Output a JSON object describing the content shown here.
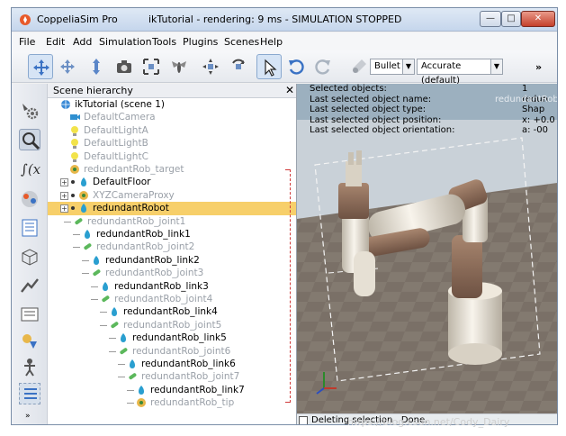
{
  "window": {
    "app_name": "CoppeliaSim Pro",
    "title": "ikTutorial - rendering: 9 ms - SIMULATION STOPPED",
    "controls": [
      "—",
      "□",
      "✕"
    ]
  },
  "menu": [
    "File",
    "Edit",
    "Add",
    "Simulation",
    "Tools",
    "Plugins",
    "Scenes",
    "Help"
  ],
  "toolbar": {
    "icons": [
      "move-camera-icon",
      "rotate-camera-icon",
      "shift-camera-icon",
      "camera-icon",
      "fit-view-icon",
      "fly-icon",
      "object-shift-icon",
      "object-rotate-icon",
      "pointer-select-icon",
      "undo-icon",
      "redo-icon",
      "dynamics-icon"
    ],
    "engine_value": "Bullet",
    "accuracy_value": "Accurate (default)",
    "more_label": "»"
  },
  "left_tools": [
    "sim-settings-icon",
    "selection-icon",
    "script-icon",
    "model-browser-icon",
    "hierarchy-icon",
    "object-properties-icon",
    "collections-icon",
    "paths-icon",
    "layers-icon",
    "user-settings-icon",
    "custom-icon"
  ],
  "left_more": "»",
  "hierarchy": {
    "title": "Scene hierarchy",
    "close": "✕",
    "root": "ikTutorial (scene 1)",
    "nodes": [
      {
        "label": "DefaultCamera",
        "dim": true
      },
      {
        "label": "DefaultLightA",
        "dim": true
      },
      {
        "label": "DefaultLightB",
        "dim": true
      },
      {
        "label": "DefaultLightC",
        "dim": true
      },
      {
        "label": "redundantRob_target",
        "dim": true
      },
      {
        "label": "DefaultFloor",
        "dim": false
      },
      {
        "label": "XYZCameraProxy",
        "dim": true
      },
      {
        "label": "redundantRobot",
        "dim": false,
        "selected": true
      },
      {
        "label": "redundantRob_joint1",
        "dim": true
      },
      {
        "label": "redundantRob_link1",
        "dim": false
      },
      {
        "label": "redundantRob_joint2",
        "dim": true
      },
      {
        "label": "redundantRob_link2",
        "dim": false
      },
      {
        "label": "redundantRob_joint3",
        "dim": true
      },
      {
        "label": "redundantRob_link3",
        "dim": false
      },
      {
        "label": "redundantRob_joint4",
        "dim": true
      },
      {
        "label": "redundantRob_link4",
        "dim": false
      },
      {
        "label": "redundantRob_joint5",
        "dim": true
      },
      {
        "label": "redundantRob_link5",
        "dim": false
      },
      {
        "label": "redundantRob_joint6",
        "dim": true
      },
      {
        "label": "redundantRob_link6",
        "dim": false
      },
      {
        "label": "redundantRob_joint7",
        "dim": true
      },
      {
        "label": "redundantRob_link7",
        "dim": false
      },
      {
        "label": "redundantRob_tip",
        "dim": true
      }
    ]
  },
  "info": {
    "rows": [
      {
        "key": "Selected objects:",
        "value": "1"
      },
      {
        "key": "Last selected object name:",
        "value": "redun"
      },
      {
        "key": "Last selected object type:",
        "value": "Shap"
      },
      {
        "key": "Last selected object position:",
        "value": "x: +0.0"
      },
      {
        "key": "Last selected object orientation:",
        "value": "a: -00"
      }
    ],
    "overlay": "redundantRob"
  },
  "status": {
    "text": "Deleting selection . Done."
  },
  "watermark": "https://blog.csdn.net/Cody_Dairy",
  "colors": {
    "selected_row": "#f7cf6a",
    "robot_white": "#ece6d9",
    "robot_brown": "#8f6d5a"
  }
}
